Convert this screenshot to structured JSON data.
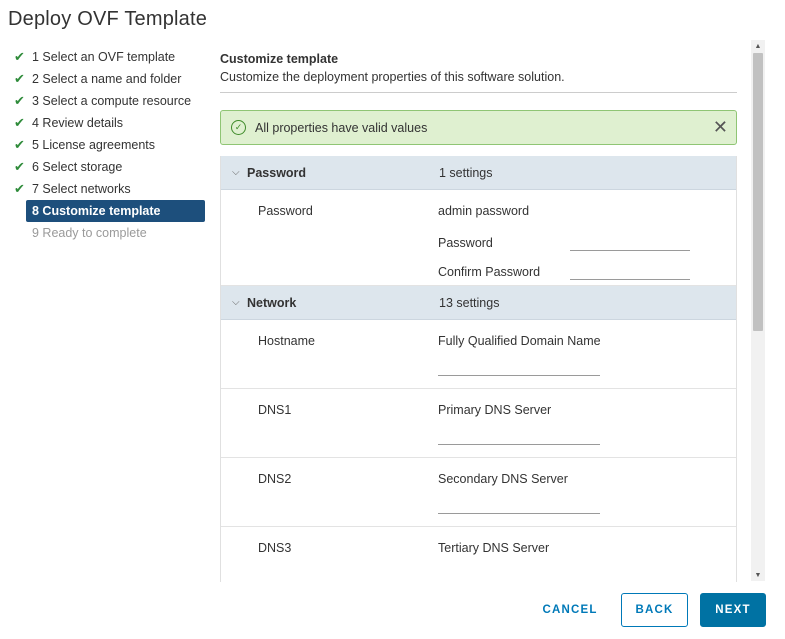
{
  "dialog": {
    "title": "Deploy OVF Template"
  },
  "steps": [
    {
      "label": "1 Select an OVF template",
      "state": "done"
    },
    {
      "label": "2 Select a name and folder",
      "state": "done"
    },
    {
      "label": "3 Select a compute resource",
      "state": "done"
    },
    {
      "label": "4 Review details",
      "state": "done"
    },
    {
      "label": "5 License agreements",
      "state": "done"
    },
    {
      "label": "6 Select storage",
      "state": "done"
    },
    {
      "label": "7 Select networks",
      "state": "done"
    },
    {
      "label": "8 Customize template",
      "state": "active"
    },
    {
      "label": "9 Ready to complete",
      "state": "disabled"
    }
  ],
  "main": {
    "heading": "Customize template",
    "description": "Customize the deployment properties of this software solution."
  },
  "alert": {
    "text": "All properties have valid values",
    "icon": "check-circle-icon",
    "close_icon": "close-icon",
    "color": "#dff0d0"
  },
  "groups": {
    "password": {
      "name": "Password",
      "count": "1 settings",
      "props": {
        "password": {
          "name": "Password",
          "description": "admin password",
          "field_label": "Password",
          "confirm_label": "Confirm Password",
          "value": "",
          "confirm_value": ""
        }
      }
    },
    "network": {
      "name": "Network",
      "count": "13 settings",
      "props": {
        "hostname": {
          "name": "Hostname",
          "description": "Fully Qualified Domain Name",
          "value": ""
        },
        "dns1": {
          "name": "DNS1",
          "description": "Primary DNS Server",
          "value": ""
        },
        "dns2": {
          "name": "DNS2",
          "description": "Secondary DNS Server",
          "value": ""
        },
        "dns3": {
          "name": "DNS3",
          "description": "Tertiary DNS Server",
          "value": ""
        }
      }
    }
  },
  "footer": {
    "cancel": "CANCEL",
    "back": "BACK",
    "next": "NEXT"
  },
  "colors": {
    "accent": "#0072a3",
    "active_step": "#1d4f7c",
    "check": "#2e8b3a",
    "group_header": "#dde6ed"
  }
}
